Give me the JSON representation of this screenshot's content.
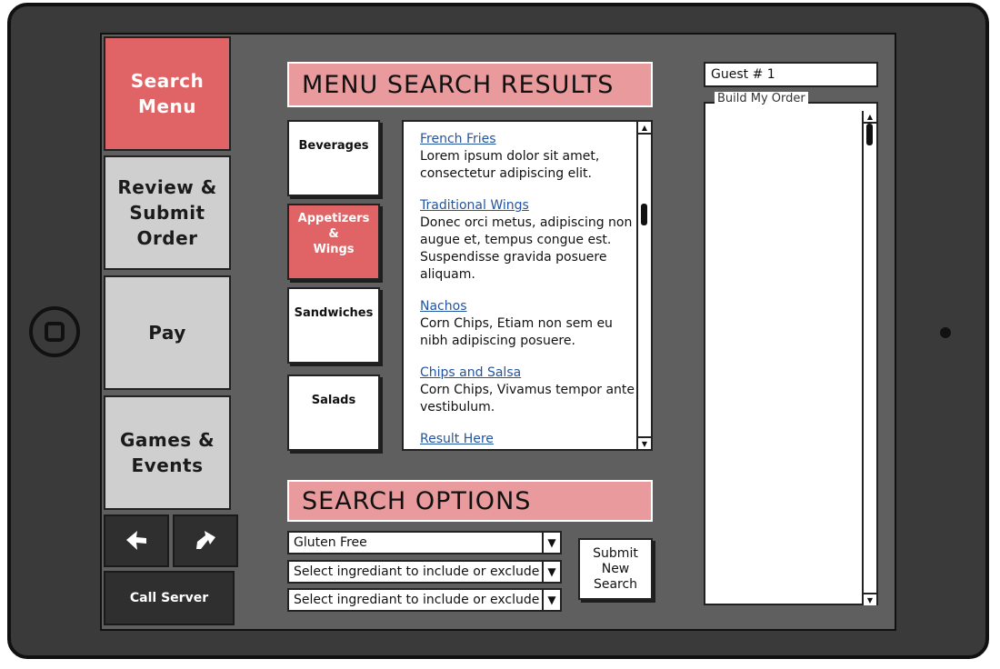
{
  "nav": {
    "search_menu": "Search\nMenu",
    "review_submit": "Review &\nSubmit\nOrder",
    "pay": "Pay",
    "games_events": "Games &\nEvents",
    "back_arrow": "arrow-back-icon",
    "forward_arrow": "arrow-forward-icon",
    "call_server": "Call Server"
  },
  "results": {
    "header": "MENU SEARCH RESULTS",
    "categories": [
      {
        "label": "Beverages",
        "selected": false
      },
      {
        "label": "Appetizers\n&\nWings",
        "selected": true
      },
      {
        "label": "Sandwiches",
        "selected": false
      },
      {
        "label": "Salads",
        "selected": false
      }
    ],
    "items": [
      {
        "title": "French Fries",
        "desc": "Lorem ipsum dolor sit amet, consectetur adipiscing elit."
      },
      {
        "title": "Traditional Wings",
        "desc": "Donec orci metus, adipiscing non augue et, tempus congue est.  Suspendisse gravida posuere aliquam."
      },
      {
        "title": "Nachos",
        "desc": "Corn Chips, Etiam non sem eu nibh adipiscing posuere."
      },
      {
        "title": "Chips and Salsa",
        "desc": "Corn Chips, Vivamus tempor ante vestibulum."
      },
      {
        "title": "Result Here",
        "desc": ""
      }
    ]
  },
  "options": {
    "header": "SEARCH OPTIONS",
    "dropdown_1": "Gluten Free",
    "dropdown_2": "Select ingrediant to include or exclude",
    "dropdown_3": "Select ingrediant to include or exclude",
    "submit": "Submit\nNew\nSearch"
  },
  "order": {
    "guest": "Guest # 1",
    "legend": "Build My Order"
  },
  "colors": {
    "active_red": "#e06466",
    "header_pink": "#e89a9d",
    "link_blue": "#2455a0"
  }
}
